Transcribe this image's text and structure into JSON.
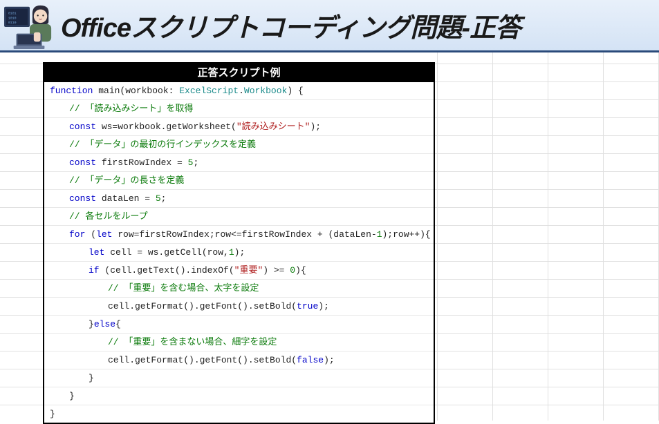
{
  "header": {
    "title": "Officeスクリプトコーディング問題-正答"
  },
  "codeHeader": "正答スクリプト例",
  "code": {
    "l0": {
      "p1": "function",
      "p2": " main(workbook: ",
      "p3": "ExcelScript",
      "p4": ".",
      "p5": "Workbook",
      "p6": ") {"
    },
    "l1": "// 「読み込みシート」を取得",
    "l2": {
      "p1": "const",
      "p2": " ws=workbook.getWorksheet(",
      "p3": "\"読み込みシート\"",
      "p4": ");"
    },
    "l3": "// 「データ」の最初の行インデックスを定義",
    "l4": {
      "p1": "const",
      "p2": " firstRowIndex = ",
      "p3": "5",
      "p4": ";"
    },
    "l5": "// 「データ」の長さを定義",
    "l6": {
      "p1": "const",
      "p2": " dataLen = ",
      "p3": "5",
      "p4": ";"
    },
    "l7": "// 各セルをループ",
    "l8": {
      "p1": "for",
      "p2": " (",
      "p3": "let",
      "p4": " row=firstRowIndex;row<=firstRowIndex + (dataLen-",
      "p5": "1",
      "p6": ");row++){"
    },
    "l9": {
      "p1": "let",
      "p2": " cell = ws.getCell(row,",
      "p3": "1",
      "p4": ");"
    },
    "l10": {
      "p1": "if",
      "p2": " (cell.getText().indexOf(",
      "p3": "\"重要\"",
      "p4": ") >= ",
      "p5": "0",
      "p6": "){"
    },
    "l11": "// 「重要」を含む場合、太字を設定",
    "l12": {
      "p1": "cell.getFormat().getFont().setBold(",
      "p2": "true",
      "p3": ");"
    },
    "l13": {
      "p1": "}",
      "p2": "else",
      "p3": "{"
    },
    "l14": "// 「重要」を含まない場合、細字を設定",
    "l15": {
      "p1": "cell.getFormat().getFont().setBold(",
      "p2": "false",
      "p3": ");"
    },
    "l16": "}",
    "l17": "}",
    "l18": "}"
  }
}
